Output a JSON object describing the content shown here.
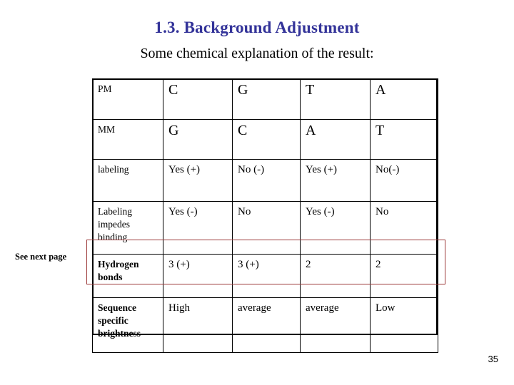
{
  "slide": {
    "title": "1.3. Background Adjustment",
    "subtitle": "Some chemical explanation of the result:",
    "page_number": "35",
    "title_color": "#333399",
    "highlight_color": "#9d3b3b"
  },
  "annotation": {
    "label": "See next page"
  },
  "table": {
    "rows": [
      {
        "label": "PM",
        "label_style": "small",
        "cells": [
          "C",
          "G",
          "T",
          "A"
        ],
        "cell_style": "nucleotide"
      },
      {
        "label": "MM",
        "label_style": "small",
        "cells": [
          "G",
          "C",
          "A",
          "T"
        ],
        "cell_style": "nucleotide"
      },
      {
        "label": "labeling",
        "label_style": "small",
        "cells": [
          "Yes (+)",
          "No (-)",
          "Yes (+)",
          "No(-)"
        ],
        "cell_style": "value"
      },
      {
        "label": "Labeling impedes binding",
        "label_style": "small",
        "cells": [
          "Yes (-)",
          "No",
          "Yes (-)",
          "No"
        ],
        "cell_style": "value"
      },
      {
        "label": "Hydrogen bonds",
        "label_style": "bold",
        "cells": [
          "3 (+)",
          "3 (+)",
          "2",
          "2"
        ],
        "cell_style": "value"
      },
      {
        "label": "Sequence specific brightness",
        "label_style": "bold",
        "cells": [
          "High",
          "average",
          "average",
          "Low"
        ],
        "cell_style": "value"
      }
    ]
  }
}
